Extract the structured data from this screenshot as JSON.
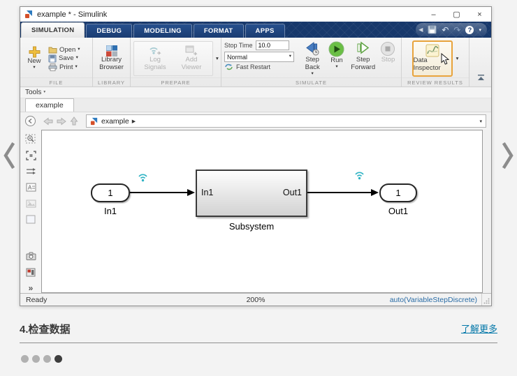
{
  "icons": {
    "caret_down": "▾",
    "breadcrumb_arrow": "▶",
    "double_chevron": "»",
    "minimize": "–",
    "maximize": "▢",
    "close": "×",
    "undo": "↶",
    "redo": "↷",
    "help": "?",
    "qat_notch": "◀",
    "collapse_ribbon": "▲"
  },
  "page": {
    "heading": "4.检查数据",
    "learn_more": "了解更多"
  },
  "window": {
    "title": "example * - Simulink",
    "tabs": [
      {
        "label": "SIMULATION"
      },
      {
        "label": "DEBUG"
      },
      {
        "label": "MODELING"
      },
      {
        "label": "FORMAT"
      },
      {
        "label": "APPS"
      }
    ],
    "ribbon": {
      "file": {
        "label": "FILE",
        "new_label": "New",
        "open_label": "Open",
        "save_label": "Save",
        "print_label": "Print"
      },
      "library": {
        "label": "LIBRARY",
        "browser_label": "Library Browser"
      },
      "prepare": {
        "label": "PREPARE",
        "log_signals_label": "Log Signals",
        "add_viewer_label": "Add Viewer"
      },
      "simulate": {
        "label": "SIMULATE",
        "stop_time_label": "Stop Time",
        "stop_time_value": "10.0",
        "mode_value": "Normal",
        "fast_restart_label": "Fast Restart",
        "step_back_label": "Step Back",
        "run_label": "Run",
        "step_forward_label": "Step Forward",
        "stop_label": "Stop"
      },
      "review": {
        "label": "REVIEW RESULTS",
        "data_inspector_label": "Data Inspector"
      }
    },
    "tools_label": "Tools",
    "doc_tab": "example",
    "breadcrumb_model": "example",
    "canvas": {
      "inport_port": "1",
      "inport_label": "In1",
      "subsystem_in": "In1",
      "subsystem_out": "Out1",
      "subsystem_label": "Subsystem",
      "outport_port": "1",
      "outport_label": "Out1"
    },
    "status": {
      "ready": "Ready",
      "zoom": "200%",
      "solver": "auto(VariableStepDiscrete)"
    }
  },
  "colors": {
    "ribbon_navy": "#17386B",
    "active_highlight": "#E8A33C",
    "run_green": "#5FB23B",
    "logging_teal": "#2FB3C4",
    "link_blue": "#0076A8"
  }
}
